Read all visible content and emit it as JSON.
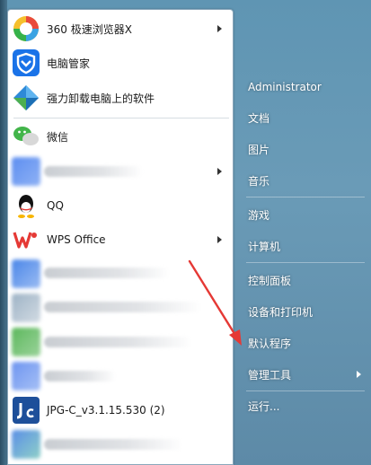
{
  "pinned_programs": [
    {
      "label": "360 极速浏览器X",
      "icon": "360-browser-icon",
      "has_submenu": true
    },
    {
      "label": "电脑管家",
      "icon": "tencent-pc-manager-icon",
      "has_submenu": false
    },
    {
      "label": "强力卸载电脑上的软件",
      "icon": "uninstaller-icon",
      "has_submenu": false
    }
  ],
  "recent_programs": [
    {
      "label": "微信",
      "icon": "wechat-icon"
    },
    {
      "label": "",
      "icon": "blurred-app-icon"
    },
    {
      "label": "QQ",
      "icon": "qq-penguin-icon"
    },
    {
      "label": "WPS Office",
      "icon": "wps-office-icon"
    },
    {
      "label": "",
      "icon": "blurred-app-icon"
    },
    {
      "label": "",
      "icon": "blurred-app-icon"
    },
    {
      "label": "",
      "icon": "blurred-app-icon"
    },
    {
      "label": "",
      "icon": "blurred-app-icon"
    },
    {
      "label": "JPG-C_v3.1.15.530 (2)",
      "icon": "jpg-c-icon"
    },
    {
      "label": "",
      "icon": "blurred-app-icon"
    }
  ],
  "right_menu": {
    "user": "Administrator",
    "items": [
      "文档",
      "图片",
      "音乐",
      "游戏",
      "计算机",
      "控制面板",
      "设备和打印机",
      "默认程序",
      "管理工具",
      "运行..."
    ]
  },
  "colors": {
    "annotation_arrow": "#e53935",
    "panel_background": "#ffffff",
    "aero_background": "#6a9bb7"
  }
}
